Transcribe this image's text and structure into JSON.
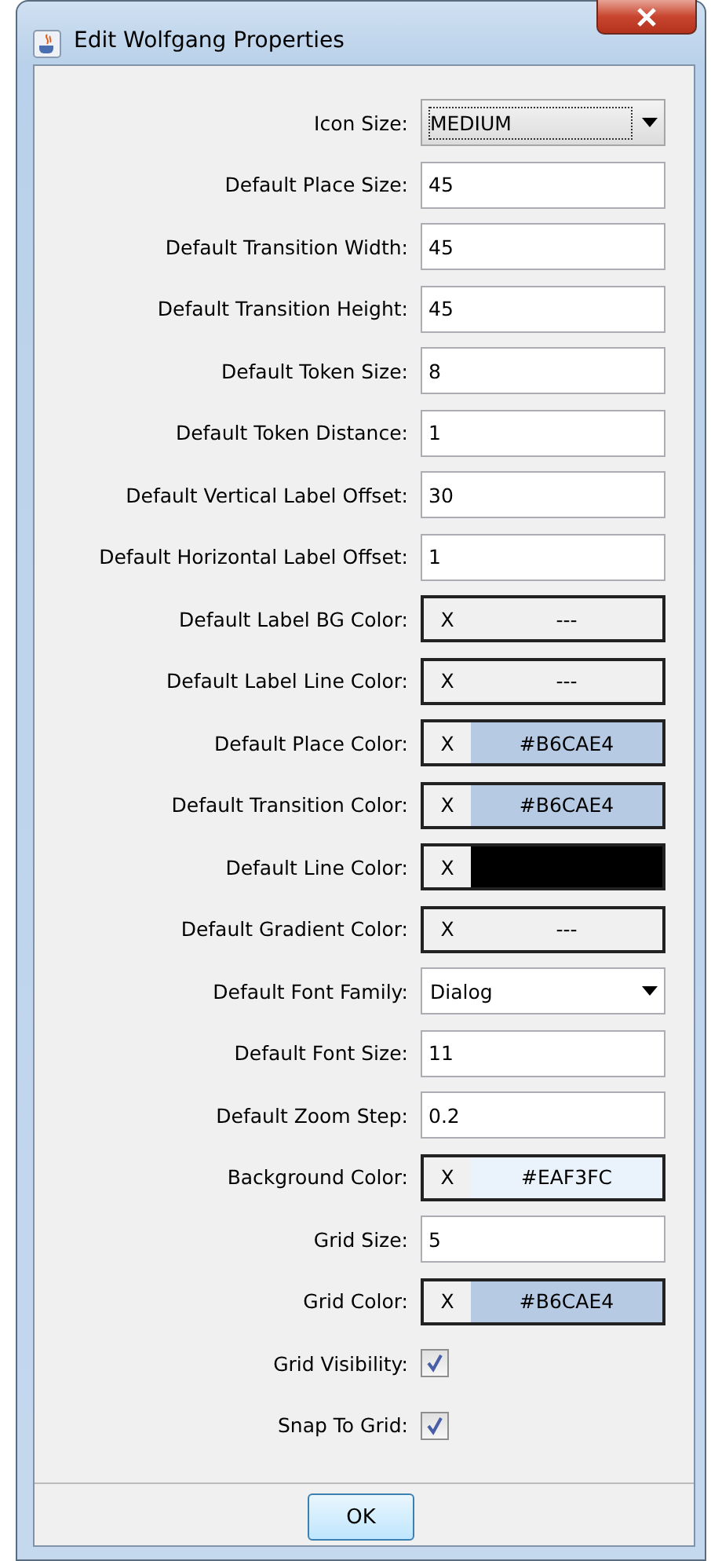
{
  "window": {
    "title": "Edit Wolfgang Properties"
  },
  "fields": [
    {
      "kind": "dropdown",
      "label": "Icon Size:",
      "value": "MEDIUM",
      "focused": true
    },
    {
      "kind": "text",
      "label": "Default Place Size:",
      "value": "45"
    },
    {
      "kind": "text",
      "label": "Default Transition Width:",
      "value": "45"
    },
    {
      "kind": "text",
      "label": "Default Transition Height:",
      "value": "45"
    },
    {
      "kind": "text",
      "label": "Default Token Size:",
      "value": "8"
    },
    {
      "kind": "text",
      "label": "Default Token Distance:",
      "value": "1"
    },
    {
      "kind": "text",
      "label": "Default Vertical Label Offset:",
      "value": "30"
    },
    {
      "kind": "text",
      "label": "Default Horizontal Label Offset:",
      "value": "1"
    },
    {
      "kind": "color",
      "label": "Default Label BG Color:",
      "clear": "X",
      "value": "---"
    },
    {
      "kind": "color",
      "label": "Default Label Line Color:",
      "clear": "X",
      "value": "---"
    },
    {
      "kind": "color",
      "label": "Default Place Color:",
      "clear": "X",
      "value": "#B6CAE4",
      "color": "#b6cae4"
    },
    {
      "kind": "color",
      "label": "Default Transition Color:",
      "clear": "X",
      "value": "#B6CAE4",
      "color": "#b6cae4"
    },
    {
      "kind": "color",
      "label": "Default Line Color:",
      "clear": "X",
      "color": "#000000"
    },
    {
      "kind": "color",
      "label": "Default Gradient Color:",
      "clear": "X",
      "value": "---"
    },
    {
      "kind": "dropdown",
      "label": "Default Font Family:",
      "value": "Dialog",
      "focused": false
    },
    {
      "kind": "text",
      "label": "Default Font Size:",
      "value": "11"
    },
    {
      "kind": "text",
      "label": "Default Zoom Step:",
      "value": "0.2"
    },
    {
      "kind": "color",
      "label": "Background Color:",
      "clear": "X",
      "value": "#EAF3FC",
      "color": "#eaf3fc"
    },
    {
      "kind": "text",
      "label": "Grid Size:",
      "value": "5"
    },
    {
      "kind": "color",
      "label": "Grid Color:",
      "clear": "X",
      "value": "#B6CAE4",
      "color": "#b6cae4"
    },
    {
      "kind": "checkbox",
      "label": "Grid Visibility:",
      "checked": true
    },
    {
      "kind": "checkbox",
      "label": "Snap To Grid:",
      "checked": true
    }
  ],
  "buttons": [
    "OK"
  ]
}
